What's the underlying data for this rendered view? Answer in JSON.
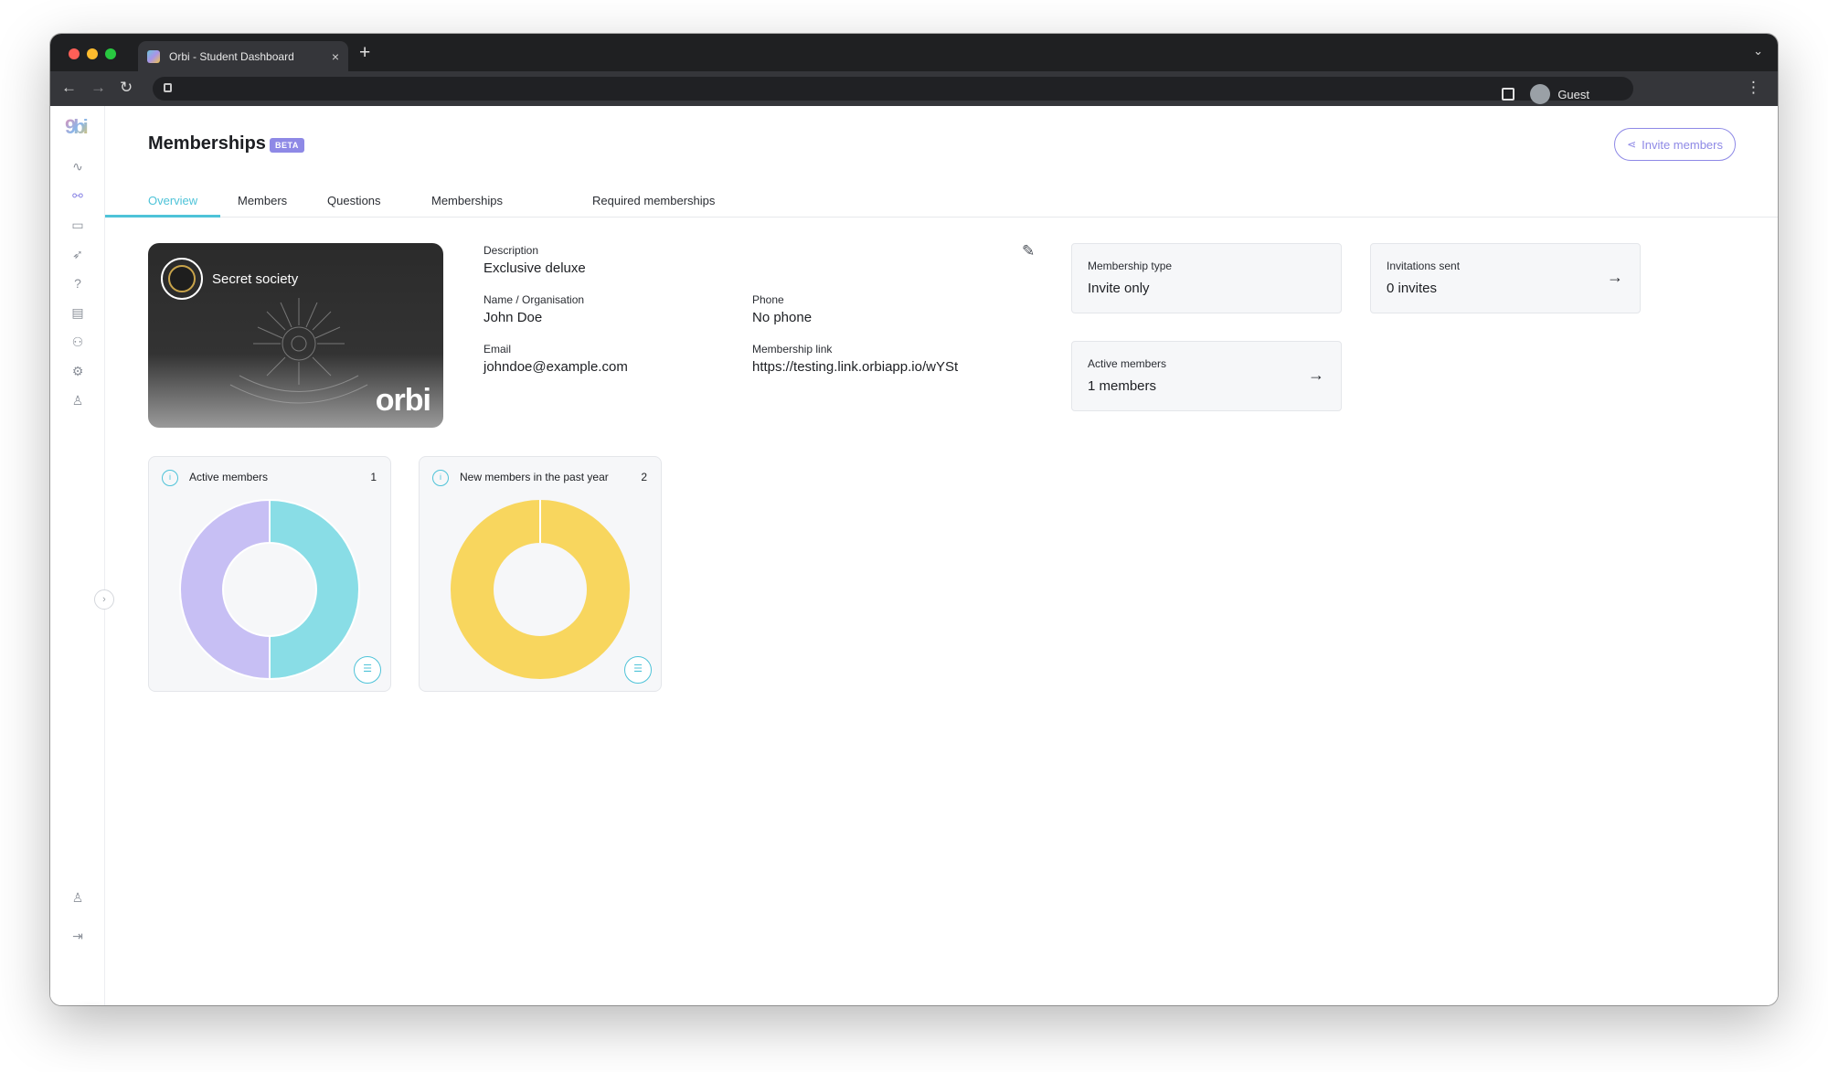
{
  "browser": {
    "tab_title": "Orbi - Student Dashboard",
    "tab_close": "×",
    "new_tab": "+",
    "tab_menu": "⌄",
    "profile_name": "Guest",
    "back": "←",
    "forward": "→",
    "reload": "↻",
    "kebab": "⋮"
  },
  "sidebar": {
    "logo": "9bi",
    "icons": [
      "activity-icon",
      "link-icon",
      "briefcase-icon",
      "rocket-icon",
      "help-icon",
      "card-icon",
      "users-icon",
      "settings-icon",
      "user-icon"
    ],
    "bottom_icons": [
      "account-icon",
      "logout-icon"
    ],
    "active_index": 1,
    "collapse": "›"
  },
  "header": {
    "title": "Memberships",
    "badge": "BETA",
    "invite_button": "Invite members"
  },
  "tabs": [
    "Overview",
    "Members",
    "Questions",
    "Memberships",
    "Required memberships"
  ],
  "card": {
    "name": "Secret society",
    "brand": "orbi"
  },
  "details": {
    "description_label": "Description",
    "description_value": "Exclusive deluxe",
    "name_label": "Name / Organisation",
    "name_value": "John Doe",
    "phone_label": "Phone",
    "phone_value": "No phone",
    "email_label": "Email",
    "email_value": "johndoe@example.com",
    "link_label": "Membership link",
    "link_value": "https://testing.link.orbiapp.io/wYSt"
  },
  "stats": {
    "membership_type_label": "Membership type",
    "membership_type_value": "Invite only",
    "invitations_label": "Invitations sent",
    "invitations_value": "0 invites",
    "active_label": "Active members",
    "active_value": "1 members",
    "arrow": "→"
  },
  "charts": {
    "active_title": "Active members",
    "active_count": "1",
    "new_title": "New members in the past year",
    "new_count": "2"
  },
  "chart_data": [
    {
      "type": "pie",
      "title": "Active members",
      "values": [
        50,
        50
      ],
      "colors": [
        "#89dde6",
        "#c7bff4"
      ]
    },
    {
      "type": "pie",
      "title": "New members in the past year",
      "values": [
        100
      ],
      "colors": [
        "#f8d65e"
      ]
    }
  ]
}
